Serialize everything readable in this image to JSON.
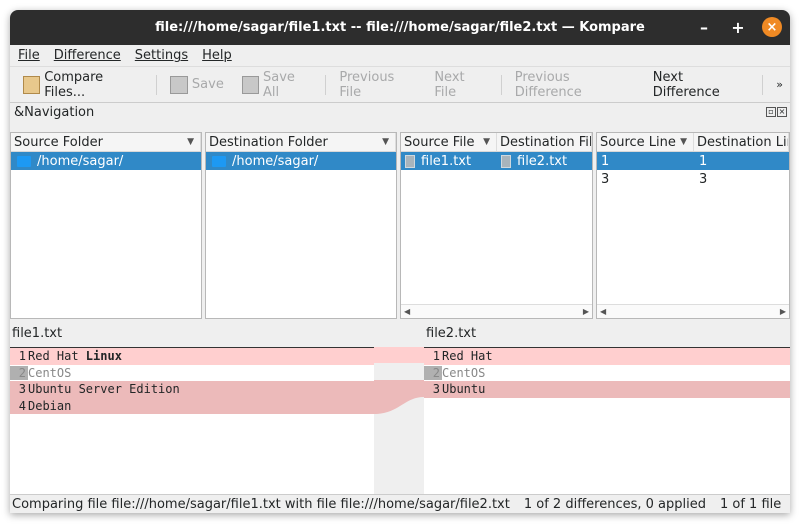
{
  "window": {
    "title": "file:///home/sagar/file1.txt -- file:///home/sagar/file2.txt — Kompare",
    "minimize": "–",
    "maximize": "+",
    "close": "×"
  },
  "menu": [
    "File",
    "Difference",
    "Settings",
    "Help"
  ],
  "toolbar": {
    "compare": "Compare Files...",
    "save": "Save",
    "save_all": "Save All",
    "prev_file": "Previous File",
    "next_file": "Next File",
    "prev_diff": "Previous Difference",
    "next_diff": "Next Difference",
    "more": "»"
  },
  "navigation": {
    "label": "&Navigation",
    "source_folder": {
      "header": "Source Folder",
      "items": [
        "/home/sagar/"
      ]
    },
    "destination_folder": {
      "header": "Destination Folder",
      "items": [
        "/home/sagar/"
      ]
    },
    "files": {
      "headers": [
        "Source File",
        "Destination Fil"
      ],
      "rows": [
        [
          "file1.txt",
          "file2.txt"
        ]
      ]
    },
    "lines": {
      "headers": [
        "Source Line",
        "Destination Lir"
      ],
      "rows": [
        [
          "1",
          "1"
        ],
        [
          "3",
          "3"
        ]
      ]
    }
  },
  "diff": {
    "left_label": "file1.txt",
    "right_label": "file2.txt",
    "left": [
      {
        "n": "1",
        "a": "Red Hat ",
        "b": "Linux"
      },
      {
        "n": "2",
        "a": "CentOS"
      },
      {
        "n": "3",
        "a": "Ubuntu Server Edition"
      },
      {
        "n": "4",
        "a": "Debian"
      }
    ],
    "right": [
      {
        "n": "1",
        "a": "Red Hat"
      },
      {
        "n": "2",
        "a": "CentOS"
      },
      {
        "n": "3",
        "a": "Ubuntu"
      }
    ]
  },
  "status": {
    "comparing": "Comparing file file:///home/sagar/file1.txt with file file:///home/sagar/file2.txt",
    "differences": "1 of 2 differences, 0 applied",
    "files": "1 of 1 file"
  }
}
